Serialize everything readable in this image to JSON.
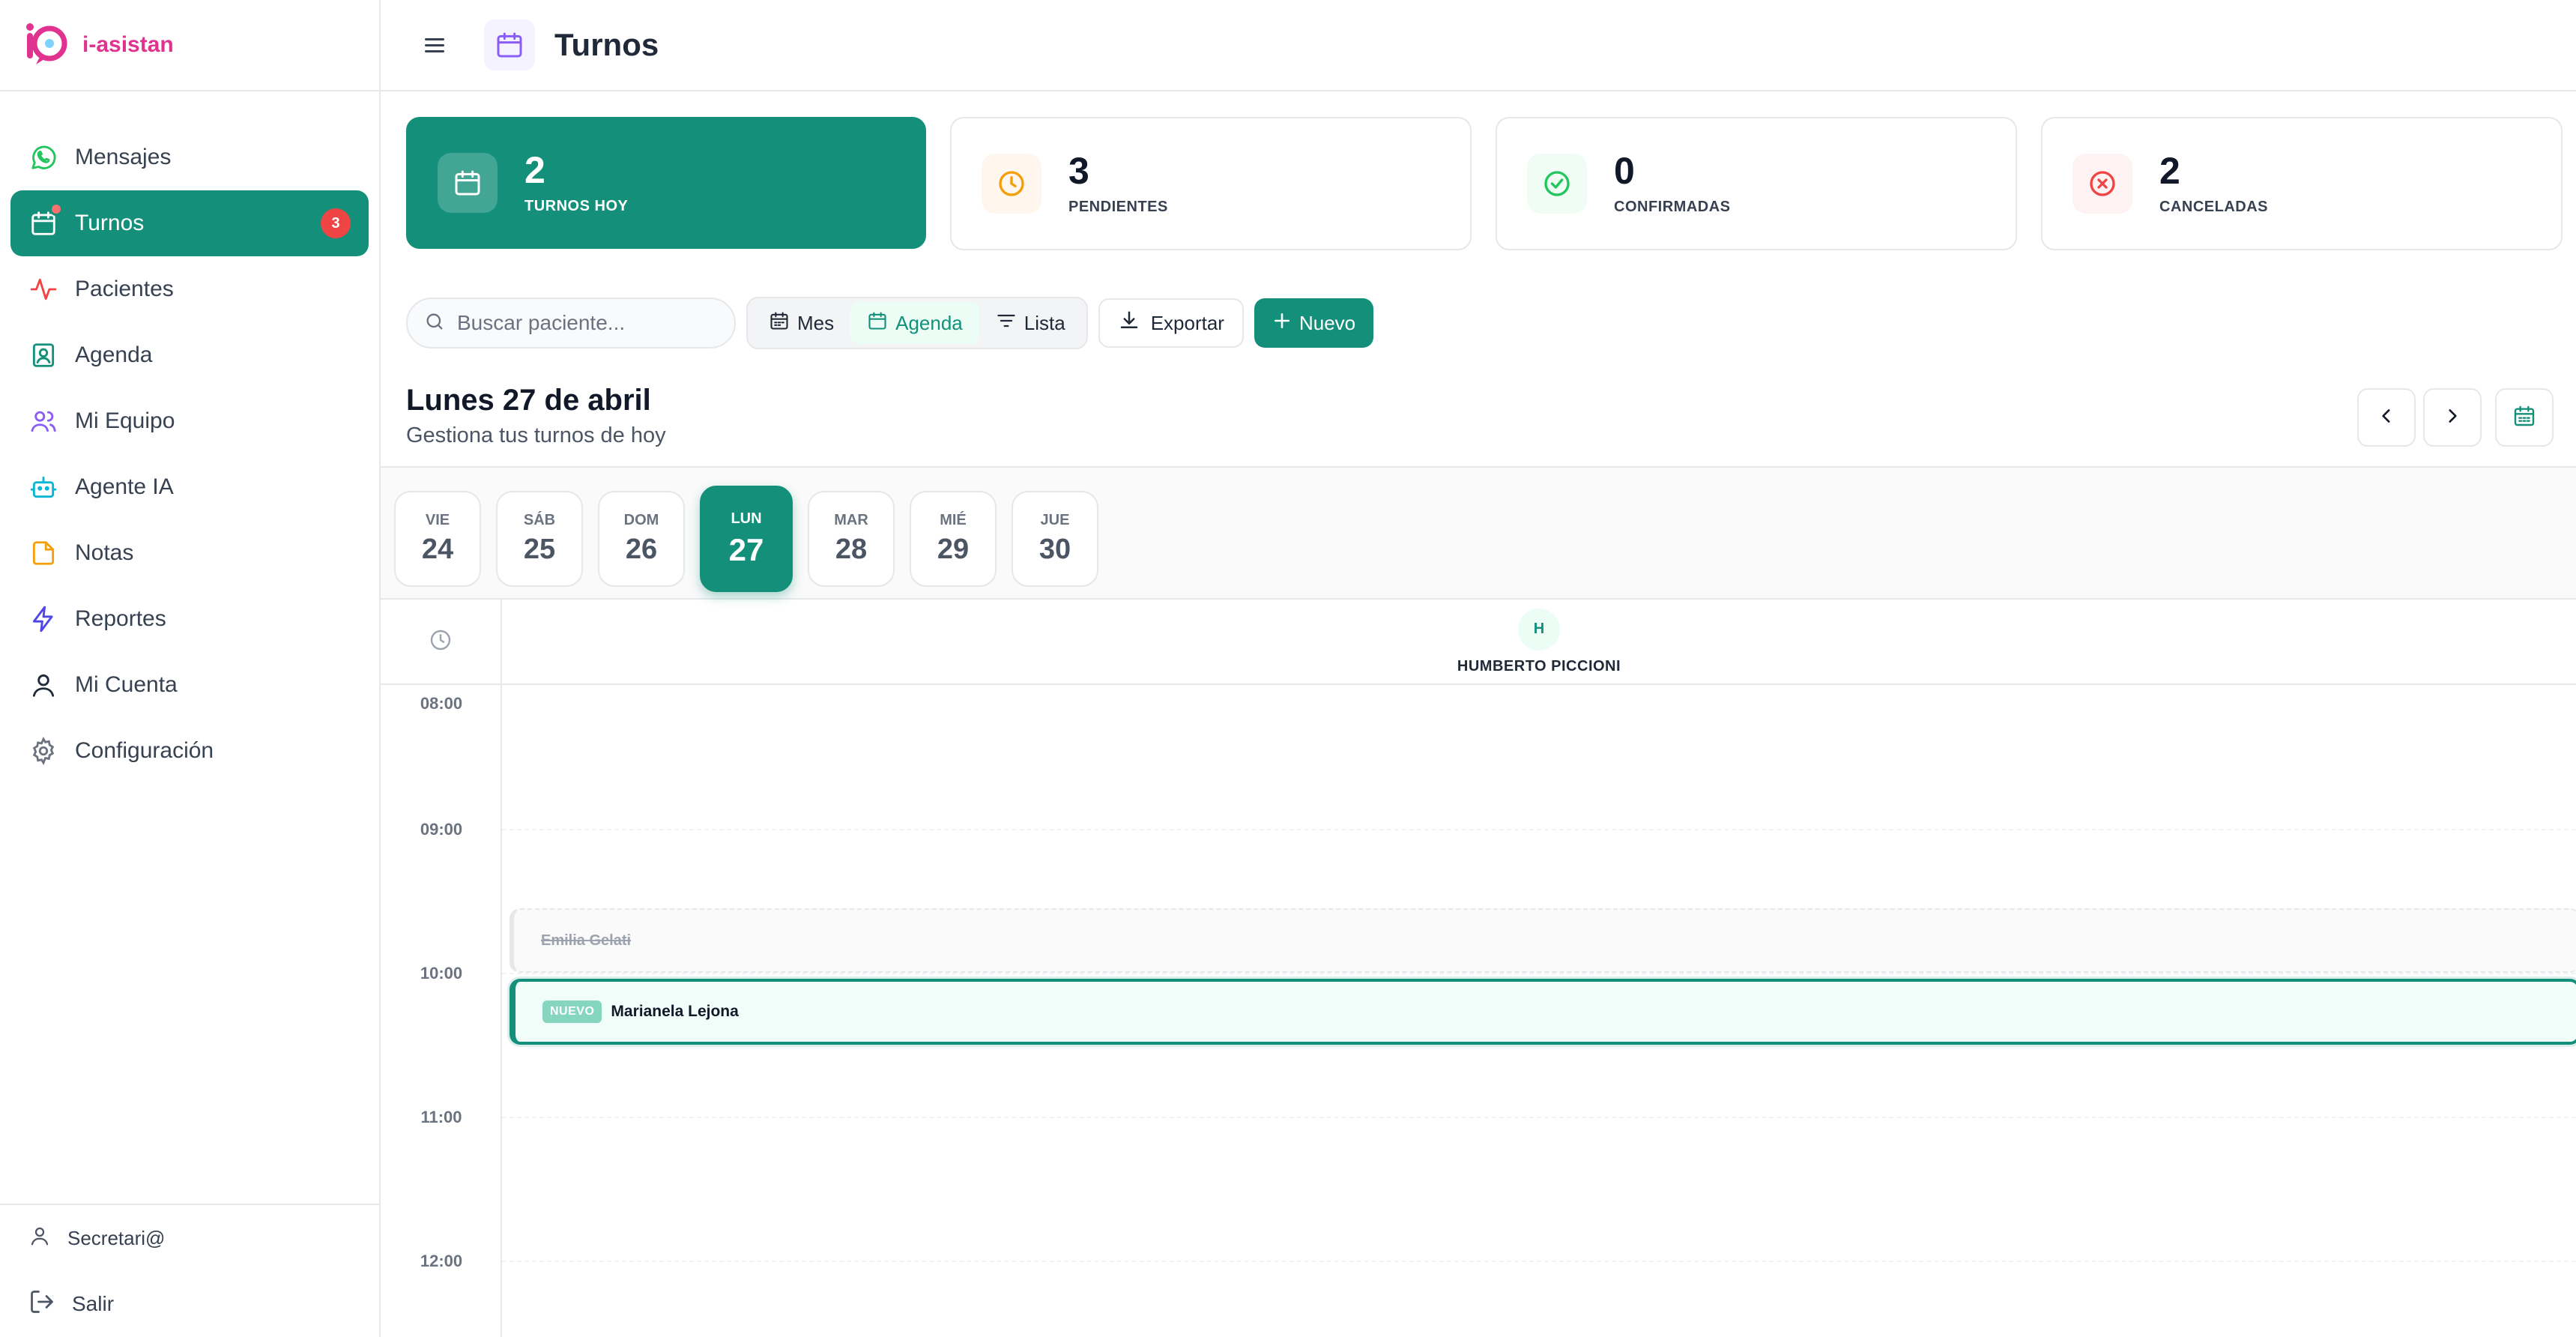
{
  "brand": {
    "name": "i-asistan"
  },
  "sidebar": {
    "items": [
      {
        "label": "Mensajes"
      },
      {
        "label": "Turnos",
        "badge": "3"
      },
      {
        "label": "Pacientes"
      },
      {
        "label": "Agenda"
      },
      {
        "label": "Mi Equipo"
      },
      {
        "label": "Agente IA"
      },
      {
        "label": "Notas"
      },
      {
        "label": "Reportes"
      },
      {
        "label": "Mi Cuenta"
      },
      {
        "label": "Configuración"
      }
    ],
    "user": "Secretari@",
    "logout": "Salir"
  },
  "header": {
    "title": "Turnos"
  },
  "stats": [
    {
      "value": "2",
      "label": "TURNOS HOY"
    },
    {
      "value": "3",
      "label": "PENDIENTES"
    },
    {
      "value": "0",
      "label": "CONFIRMADAS"
    },
    {
      "value": "2",
      "label": "CANCELADAS"
    }
  ],
  "toolbar": {
    "search_placeholder": "Buscar paciente...",
    "views": [
      "Mes",
      "Agenda",
      "Lista"
    ],
    "active_view": "Agenda",
    "export_label": "Exportar",
    "new_label": "Nuevo"
  },
  "day": {
    "title": "Lunes 27 de abril",
    "subtitle": "Gestiona tus turnos de hoy"
  },
  "days": [
    {
      "name": "VIE",
      "num": "24"
    },
    {
      "name": "SÁB",
      "num": "25"
    },
    {
      "name": "DOM",
      "num": "26"
    },
    {
      "name": "LUN",
      "num": "27"
    },
    {
      "name": "MAR",
      "num": "28"
    },
    {
      "name": "MIÉ",
      "num": "29"
    },
    {
      "name": "JUE",
      "num": "30"
    }
  ],
  "professional": {
    "initial": "H",
    "name": "HUMBERTO PICCIONI"
  },
  "times": [
    "08:00",
    "09:00",
    "10:00",
    "11:00",
    "12:00"
  ],
  "appointments": [
    {
      "patient": "Emilia Gelati",
      "status": "cancelada"
    },
    {
      "patient": "Marianela Lejona",
      "tag": "NUEVO"
    }
  ],
  "colors": {
    "accent": "#14907a",
    "brand": "#e0338f",
    "danger": "#ef4444"
  }
}
